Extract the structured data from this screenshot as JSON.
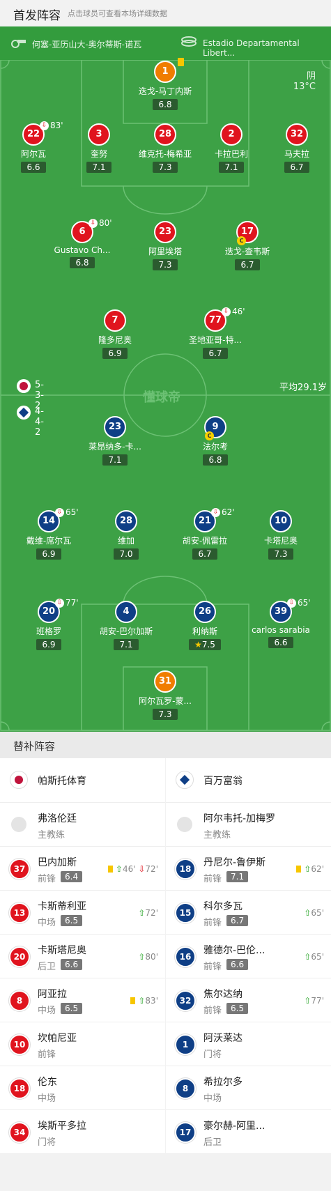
{
  "header": {
    "title": "首发阵容",
    "subtitle": "点击球员可查看本场详细数据"
  },
  "match": {
    "coach_label": "何塞-亚历山大-奥尔蒂斯-诺瓦",
    "venue": "Estadio Departamental Libert...",
    "weather": "阴",
    "temp": "13°C",
    "watermark": "懂球帝"
  },
  "home": {
    "formation": "5-3-2",
    "avg_age": "平均29.1岁",
    "players": [
      {
        "num": "1",
        "name": "迭戈-马丁内斯",
        "rating": "6.8"
      },
      {
        "num": "22",
        "name": "阿尔瓦",
        "rating": "6.6",
        "sub": "83'"
      },
      {
        "num": "3",
        "name": "奎努",
        "rating": "7.1"
      },
      {
        "num": "28",
        "name": "维克托-梅希亚",
        "rating": "7.3"
      },
      {
        "num": "2",
        "name": "卡拉巴利",
        "rating": "7.1"
      },
      {
        "num": "32",
        "name": "马夫拉",
        "rating": "6.7"
      },
      {
        "num": "6",
        "name": "Gustavo Ch...",
        "rating": "6.8",
        "sub": "80'"
      },
      {
        "num": "23",
        "name": "阿里埃塔",
        "rating": "7.3"
      },
      {
        "num": "17",
        "name": "迭戈-查韦斯",
        "rating": "6.7"
      },
      {
        "num": "7",
        "name": "隆多尼奥",
        "rating": "6.9"
      },
      {
        "num": "77",
        "name": "圣地亚哥-特...",
        "rating": "6.7",
        "sub": "46'"
      }
    ]
  },
  "away": {
    "formation": "4-4-2",
    "players": [
      {
        "num": "23",
        "name": "莱昂纳多-卡...",
        "rating": "7.1"
      },
      {
        "num": "9",
        "name": "法尔考",
        "rating": "6.8"
      },
      {
        "num": "14",
        "name": "戴维-席尔瓦",
        "rating": "6.9",
        "sub": "65'"
      },
      {
        "num": "28",
        "name": "维加",
        "rating": "7.0"
      },
      {
        "num": "21",
        "name": "胡安-佩雷拉",
        "rating": "6.7",
        "sub": "62'"
      },
      {
        "num": "10",
        "name": "卡塔尼奥",
        "rating": "7.3"
      },
      {
        "num": "20",
        "name": "班格罗",
        "rating": "6.9",
        "sub": "77'"
      },
      {
        "num": "4",
        "name": "胡安-巴尔加斯",
        "rating": "7.1"
      },
      {
        "num": "26",
        "name": "利纳斯",
        "rating": "7.5"
      },
      {
        "num": "39",
        "name": "carlos sarabia",
        "rating": "6.6",
        "sub": "65'"
      },
      {
        "num": "31",
        "name": "阿尔瓦罗-蒙...",
        "rating": "7.3"
      }
    ]
  },
  "subs": {
    "title": "替补阵容",
    "home_team": "帕斯托体育",
    "away_team": "百万富翁",
    "coach_role": "主教练",
    "home_coach": "弗洛伦廷",
    "away_coach": "阿尔韦托-加梅罗",
    "home": [
      {
        "num": "37",
        "name": "巴内加斯",
        "pos": "前锋",
        "rating": "6.4",
        "ev_in": "46'",
        "ev_out": "72'"
      },
      {
        "num": "13",
        "name": "卡斯蒂利亚",
        "pos": "中场",
        "rating": "6.5",
        "ev_in": "72'"
      },
      {
        "num": "20",
        "name": "卡斯塔尼奥",
        "pos": "后卫",
        "rating": "6.6",
        "ev_in": "80'"
      },
      {
        "num": "8",
        "name": "阿亚拉",
        "pos": "中场",
        "rating": "6.5",
        "ev_in": "83'"
      },
      {
        "num": "10",
        "name": "坎帕尼亚",
        "pos": "前锋"
      },
      {
        "num": "18",
        "name": "伦东",
        "pos": "中场"
      },
      {
        "num": "34",
        "name": "埃斯平多拉",
        "pos": "门将"
      }
    ],
    "away": [
      {
        "num": "18",
        "name": "丹尼尔-鲁伊斯",
        "pos": "前锋",
        "rating": "7.1",
        "ev_in": "62'"
      },
      {
        "num": "15",
        "name": "科尔多瓦",
        "pos": "前锋",
        "rating": "6.7",
        "ev_in": "65'"
      },
      {
        "num": "16",
        "name": "雅德尔-巴伦...",
        "pos": "前锋",
        "rating": "6.6",
        "ev_in": "65'"
      },
      {
        "num": "32",
        "name": "焦尔达纳",
        "pos": "前锋",
        "rating": "6.5",
        "ev_in": "77'"
      },
      {
        "num": "1",
        "name": "阿沃莱达",
        "pos": "门将"
      },
      {
        "num": "8",
        "name": "希拉尔多",
        "pos": "中场"
      },
      {
        "num": "17",
        "name": "豪尔赫-阿里...",
        "pos": "后卫"
      }
    ]
  }
}
